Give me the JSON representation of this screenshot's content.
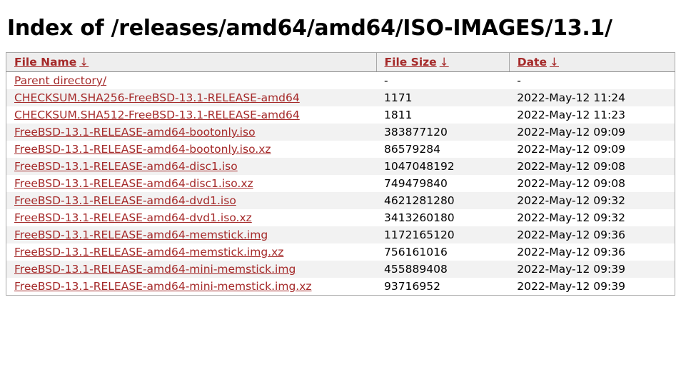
{
  "page": {
    "title": "Index of /releases/amd64/amd64/ISO-IMAGES/13.1/",
    "link_color": "#a52a2a",
    "header_background": "#eeeeee",
    "stripe_color": "#f2f2f2",
    "border_color": "#a8a8a8"
  },
  "table": {
    "headers": [
      {
        "label": "File Name",
        "sort_icon": "↓",
        "sort_icon_name": "sort-descending-arrow-icon"
      },
      {
        "label": "File Size",
        "sort_icon": "↓",
        "sort_icon_name": "sort-descending-arrow-icon"
      },
      {
        "label": "Date",
        "sort_icon": "↓",
        "sort_icon_name": "sort-descending-arrow-icon"
      }
    ],
    "rows": [
      {
        "name": "Parent directory/",
        "size": "-",
        "date": "-"
      },
      {
        "name": "CHECKSUM.SHA256-FreeBSD-13.1-RELEASE-amd64",
        "size": "1171",
        "date": "2022-May-12 11:24"
      },
      {
        "name": "CHECKSUM.SHA512-FreeBSD-13.1-RELEASE-amd64",
        "size": "1811",
        "date": "2022-May-12 11:23"
      },
      {
        "name": "FreeBSD-13.1-RELEASE-amd64-bootonly.iso",
        "size": "383877120",
        "date": "2022-May-12 09:09"
      },
      {
        "name": "FreeBSD-13.1-RELEASE-amd64-bootonly.iso.xz",
        "size": "86579284",
        "date": "2022-May-12 09:09"
      },
      {
        "name": "FreeBSD-13.1-RELEASE-amd64-disc1.iso",
        "size": "1047048192",
        "date": "2022-May-12 09:08"
      },
      {
        "name": "FreeBSD-13.1-RELEASE-amd64-disc1.iso.xz",
        "size": "749479840",
        "date": "2022-May-12 09:08"
      },
      {
        "name": "FreeBSD-13.1-RELEASE-amd64-dvd1.iso",
        "size": "4621281280",
        "date": "2022-May-12 09:32"
      },
      {
        "name": "FreeBSD-13.1-RELEASE-amd64-dvd1.iso.xz",
        "size": "3413260180",
        "date": "2022-May-12 09:32"
      },
      {
        "name": "FreeBSD-13.1-RELEASE-amd64-memstick.img",
        "size": "1172165120",
        "date": "2022-May-12 09:36"
      },
      {
        "name": "FreeBSD-13.1-RELEASE-amd64-memstick.img.xz",
        "size": "756161016",
        "date": "2022-May-12 09:36"
      },
      {
        "name": "FreeBSD-13.1-RELEASE-amd64-mini-memstick.img",
        "size": "455889408",
        "date": "2022-May-12 09:39"
      },
      {
        "name": "FreeBSD-13.1-RELEASE-amd64-mini-memstick.img.xz",
        "size": "93716952",
        "date": "2022-May-12 09:39"
      }
    ]
  }
}
